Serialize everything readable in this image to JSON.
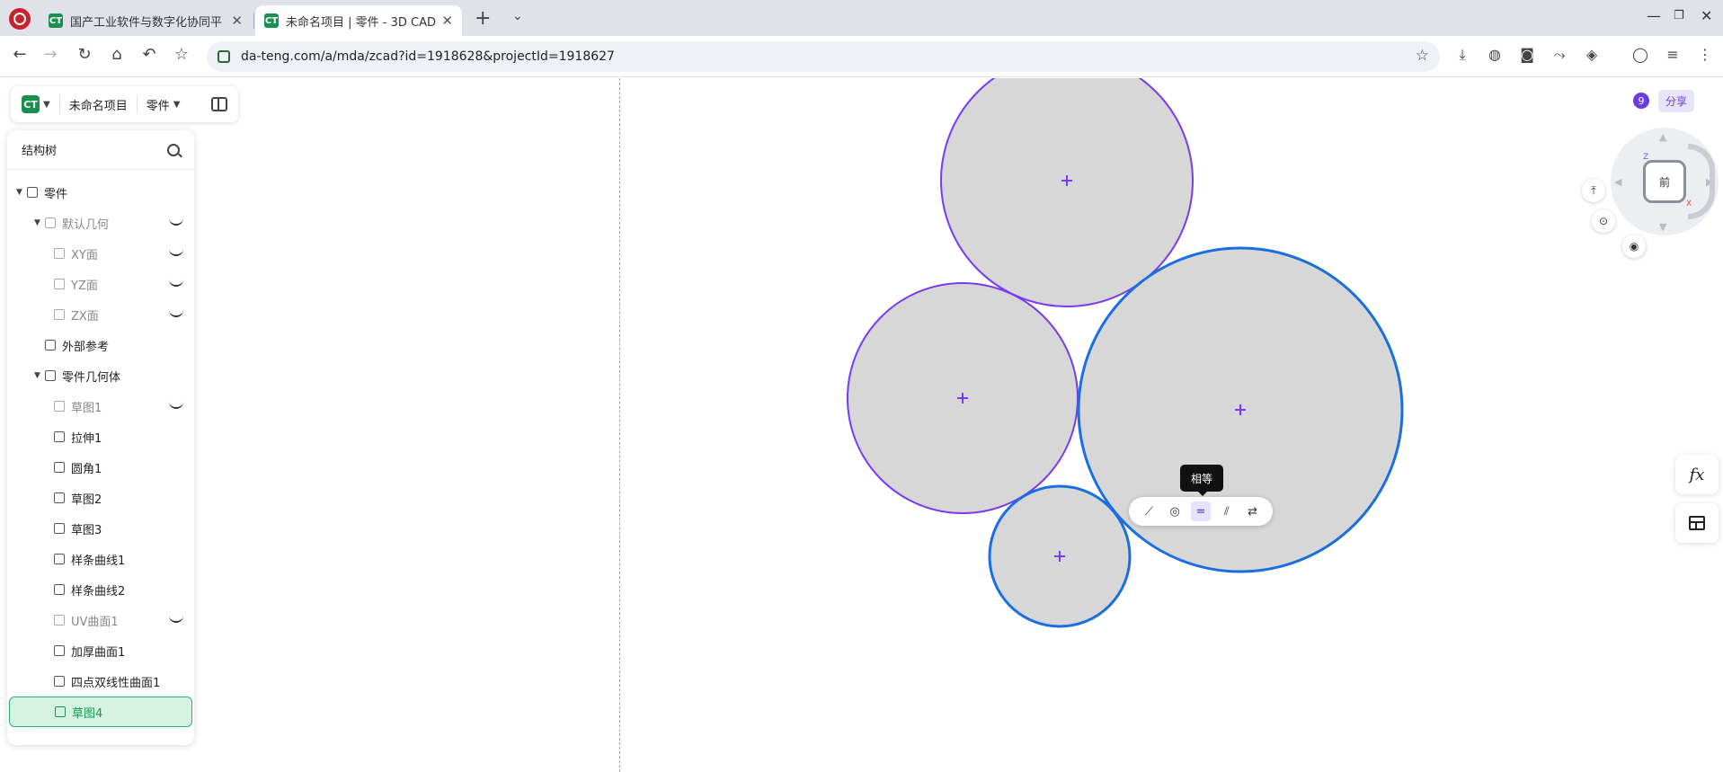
{
  "browser": {
    "tabs": [
      {
        "title": "国产工业软件与数字化协同平",
        "favicon": "CT",
        "active": false
      },
      {
        "title": "未命名项目 | 零件 - 3D CAD",
        "favicon": "CT",
        "active": true
      }
    ],
    "url": "da-teng.com/a/mda/zcad?id=1918628&projectId=1918627"
  },
  "app": {
    "project_name": "未命名项目",
    "doc_type": "零件",
    "logo": "CT",
    "share_label": "分享",
    "collaborator_count": "9"
  },
  "tree": {
    "title": "结构树",
    "items": [
      {
        "label": "零件"
      },
      {
        "label": "默认几何"
      },
      {
        "label": "XY面"
      },
      {
        "label": "YZ面"
      },
      {
        "label": "ZX面"
      },
      {
        "label": "外部参考"
      },
      {
        "label": "零件几何体"
      },
      {
        "label": "草图1"
      },
      {
        "label": "拉伸1"
      },
      {
        "label": "圆角1"
      },
      {
        "label": "草图2"
      },
      {
        "label": "草图3"
      },
      {
        "label": "样条曲线1"
      },
      {
        "label": "样条曲线2"
      },
      {
        "label": "UV曲面1"
      },
      {
        "label": "加厚曲面1"
      },
      {
        "label": "四点双线性曲面1"
      },
      {
        "label": "草图4"
      }
    ]
  },
  "viewcube": {
    "face": "前",
    "axis_z": "Z",
    "axis_x": "X"
  },
  "constraint_toolbar": {
    "tooltip": "相等",
    "tools": [
      "tangent-icon",
      "concentric-icon",
      "equal-icon",
      "parallel-icon",
      "symmetric-icon"
    ]
  },
  "right_panel": {
    "formula_label": "fx"
  },
  "colors": {
    "accent": "#6a3dde",
    "selected_circle": "#1a6fe0",
    "circle_stroke": "#7a3af0",
    "circle_fill": "#d7d7d7",
    "brand_green": "#1a8f4f"
  }
}
